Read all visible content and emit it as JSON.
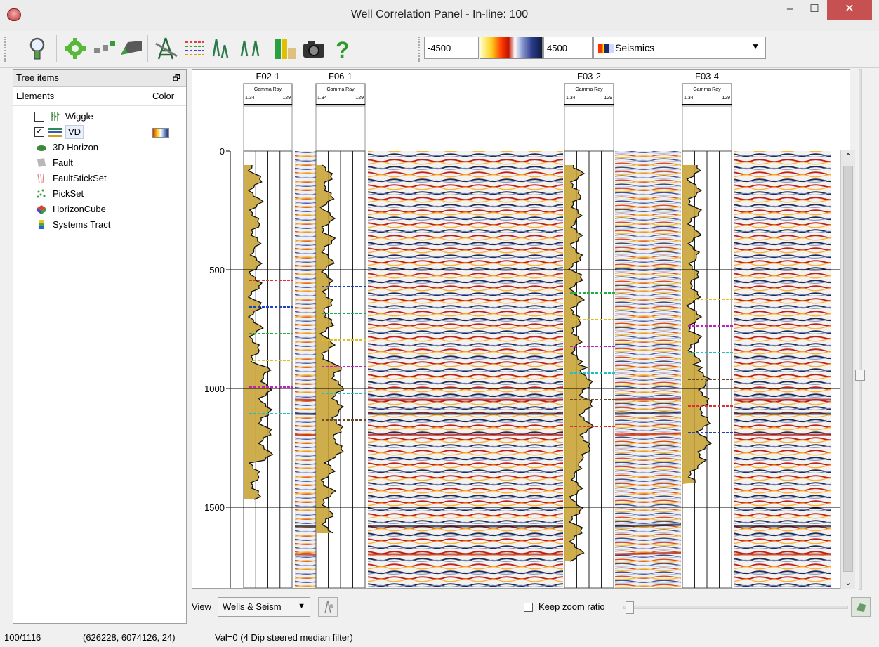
{
  "window": {
    "title": "Well Correlation Panel - In-line: 100",
    "min": "–",
    "max": "☐",
    "close": "✕"
  },
  "toolbar": {
    "icons": [
      "magnifier-icon",
      "gear-icon",
      "objects-icon",
      "surface-icon",
      "wellfault-icon",
      "markers-icon",
      "well-a-icon",
      "well-b-icon",
      "bars-icon",
      "camera-icon",
      "help-icon"
    ],
    "min_value": "-4500",
    "max_value": "4500",
    "colortable": "Seismics"
  },
  "tree": {
    "header": "Tree items",
    "col_elements": "Elements",
    "col_color": "Color",
    "items": [
      {
        "label": "Wiggle",
        "checked": false
      },
      {
        "label": "VD",
        "checked": true
      },
      {
        "label": "3D Horizon"
      },
      {
        "label": "Fault"
      },
      {
        "label": "FaultStickSet"
      },
      {
        "label": "PickSet"
      },
      {
        "label": "HorizonCube"
      },
      {
        "label": "Systems Tract"
      }
    ]
  },
  "panel": {
    "wells": [
      {
        "name": "F02-1",
        "log": "Gamma Ray",
        "min": "1.34",
        "max": "129"
      },
      {
        "name": "F06-1",
        "log": "Gamma Ray",
        "min": "1.34",
        "max": "129"
      },
      {
        "name": "F03-2",
        "log": "Gamma Ray",
        "min": "1.34",
        "max": "129"
      },
      {
        "name": "F03-4",
        "log": "Gamma Ray",
        "min": "1.34",
        "max": "129"
      }
    ],
    "depth_ticks": [
      "0",
      "500",
      "1000",
      "1500"
    ]
  },
  "bottom": {
    "view_label": "View",
    "view_value": "Wells & Seism",
    "keep_zoom": "Keep zoom ratio"
  },
  "status": {
    "position": "100/1116",
    "coords": "(626228, 6074126, 24)",
    "value": "Val=0 (4 Dip steered median filter)"
  }
}
